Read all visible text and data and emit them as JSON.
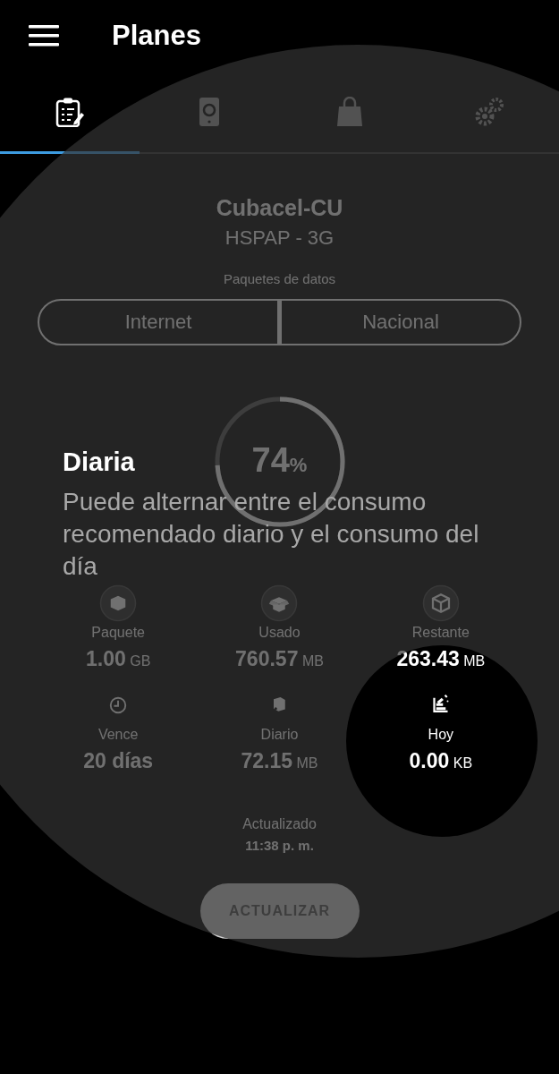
{
  "app_bar": {
    "title": "Planes"
  },
  "tabs": [
    {
      "kind": "clipboard",
      "selected": true
    },
    {
      "kind": "money",
      "selected": false
    },
    {
      "kind": "bag",
      "selected": false
    },
    {
      "kind": "gears",
      "selected": false
    }
  ],
  "network": {
    "operator": "Cubacel-CU",
    "technology": "HSPAP - 3G"
  },
  "packages": {
    "label": "Paquetes de datos",
    "options": [
      {
        "label": "Internet"
      },
      {
        "label": "Nacional"
      }
    ]
  },
  "usage": {
    "level": 0.74,
    "percent": "74",
    "unit": "%"
  },
  "stats": [
    {
      "kind": "package",
      "label": "Paquete",
      "value": "1.00",
      "unit": "GB"
    },
    {
      "kind": "used",
      "label": "Usado",
      "value": "760.57",
      "unit": "MB"
    },
    {
      "kind": "remaining",
      "label": "Restante",
      "value": "263.43",
      "unit": "MB"
    },
    {
      "kind": "expires",
      "label": "Vence",
      "value": "20 días"
    },
    {
      "kind": "daily",
      "label": "Diario",
      "value": "72.15",
      "unit": "MB"
    },
    {
      "kind": "today",
      "label": "Hoy",
      "value": "0.00",
      "unit": "KB"
    }
  ],
  "updated": {
    "label": "Actualizado",
    "time": "11:38 p. m."
  },
  "refresh_button": {
    "label": "ACTUALIZAR"
  },
  "tip": {
    "title": "Diaria",
    "text": "Puede alternar entre el consumo recomendado diario y el consumo del día"
  }
}
